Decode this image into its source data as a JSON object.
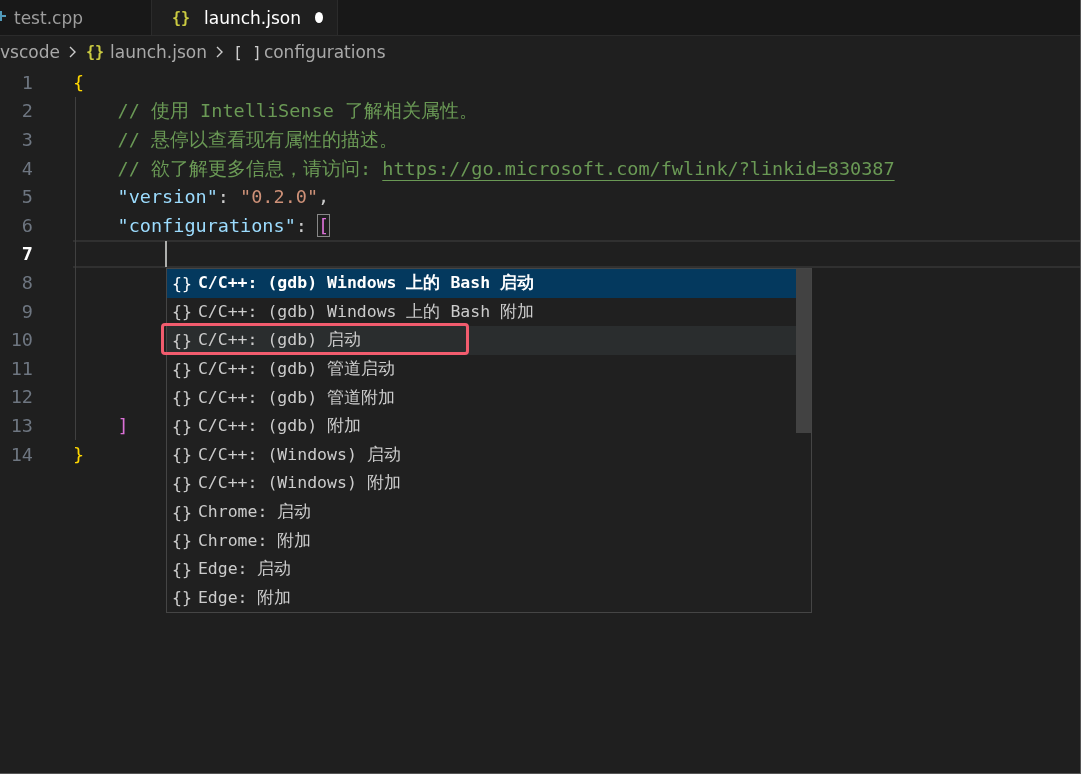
{
  "tabs": [
    {
      "kind": "cpp",
      "label": "test.cpp",
      "selected": false,
      "dirty": false
    },
    {
      "kind": "json",
      "glyph": "{}",
      "label": "launch.json",
      "selected": true,
      "dirty": true
    }
  ],
  "breadcrumbs": [
    {
      "label": "vscode"
    },
    {
      "glyph": "{}",
      "label": "launch.json"
    },
    {
      "glyph": "[ ]",
      "label": "configurations"
    }
  ],
  "editor": {
    "lines": [
      {
        "number": "1",
        "current": false,
        "tokens": [
          {
            "kind": "brace",
            "text": "{"
          }
        ]
      },
      {
        "number": "2",
        "current": false,
        "tokens": [
          {
            "kind": "comment",
            "text": "    // 使用 IntelliSense 了解相关属性。"
          }
        ]
      },
      {
        "number": "3",
        "current": false,
        "tokens": [
          {
            "kind": "comment",
            "text": "    // 悬停以查看现有属性的描述。"
          }
        ]
      },
      {
        "number": "4",
        "current": false,
        "tokens": [
          {
            "kind": "comment",
            "text": "    // 欲了解更多信息，请访问: "
          },
          {
            "kind": "link",
            "text": "https://go.microsoft.com/fwlink/?linkid=830387"
          }
        ]
      },
      {
        "number": "5",
        "current": false,
        "tokens": [
          {
            "kind": "key",
            "text": "    \"version\""
          },
          {
            "kind": "punct",
            "text": ": "
          },
          {
            "kind": "string",
            "text": "\"0.2.0\""
          },
          {
            "kind": "punct",
            "text": ","
          }
        ]
      },
      {
        "number": "6",
        "current": false,
        "tokens": [
          {
            "kind": "key",
            "text": "    \"configurations\""
          },
          {
            "kind": "punct",
            "text": ": "
          },
          {
            "kind": "bracket",
            "text": "[",
            "matched": true
          }
        ]
      },
      {
        "number": "7",
        "current": true,
        "cursor": true
      },
      {
        "number": "8",
        "current": false
      },
      {
        "number": "9",
        "current": false
      },
      {
        "number": "10",
        "current": false
      },
      {
        "number": "11",
        "current": false
      },
      {
        "number": "12",
        "current": false
      },
      {
        "number": "13",
        "current": false,
        "tokens": [
          {
            "kind": "bracket",
            "text": "    ]",
            "matched": false
          }
        ]
      },
      {
        "number": "14",
        "current": false,
        "tokens": [
          {
            "kind": "brace",
            "text": "}"
          }
        ]
      }
    ]
  },
  "suggestions": [
    {
      "glyph": "{}",
      "label": "C/C++: (gdb) Windows 上的 Bash 启动",
      "selected": true,
      "hovered": false,
      "outlined": false
    },
    {
      "glyph": "{}",
      "label": "C/C++: (gdb) Windows 上的 Bash 附加",
      "selected": false,
      "hovered": false,
      "outlined": false
    },
    {
      "glyph": "{}",
      "label": "C/C++: (gdb) 启动",
      "selected": false,
      "hovered": true,
      "outlined": true
    },
    {
      "glyph": "{}",
      "label": "C/C++: (gdb) 管道启动",
      "selected": false,
      "hovered": false,
      "outlined": false
    },
    {
      "glyph": "{}",
      "label": "C/C++: (gdb) 管道附加",
      "selected": false,
      "hovered": false,
      "outlined": false
    },
    {
      "glyph": "{}",
      "label": "C/C++: (gdb) 附加",
      "selected": false,
      "hovered": false,
      "outlined": false
    },
    {
      "glyph": "{}",
      "label": "C/C++: (Windows) 启动",
      "selected": false,
      "hovered": false,
      "outlined": false
    },
    {
      "glyph": "{}",
      "label": "C/C++: (Windows) 附加",
      "selected": false,
      "hovered": false,
      "outlined": false
    },
    {
      "glyph": "{}",
      "label": "Chrome: 启动",
      "selected": false,
      "hovered": false,
      "outlined": false
    },
    {
      "glyph": "{}",
      "label": "Chrome: 附加",
      "selected": false,
      "hovered": false,
      "outlined": false
    },
    {
      "glyph": "{}",
      "label": "Edge: 启动",
      "selected": false,
      "hovered": false,
      "outlined": false
    },
    {
      "glyph": "{}",
      "label": "Edge: 附加",
      "selected": false,
      "hovered": false,
      "outlined": false
    }
  ]
}
